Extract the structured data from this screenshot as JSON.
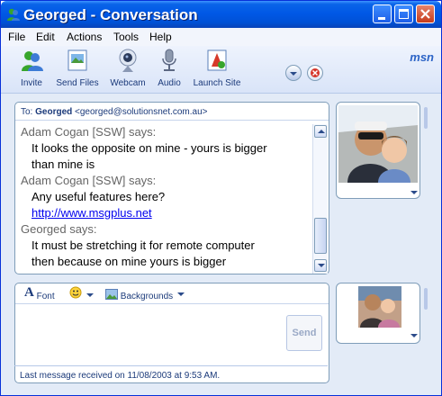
{
  "window": {
    "title": "Georged - Conversation"
  },
  "menu": [
    "File",
    "Edit",
    "Actions",
    "Tools",
    "Help"
  ],
  "toolbar": {
    "items": [
      "Invite",
      "Send Files",
      "Webcam",
      "Audio",
      "Launch Site"
    ],
    "brand": "msn"
  },
  "conversation": {
    "to_label": "To:",
    "to_name": "Georged",
    "to_email": "<georged@solutionsnet.com.au>",
    "messages": [
      {
        "who": "Adam Cogan [SSW] says:",
        "lines": [
          "It looks the opposite on mine - yours is bigger",
          "than mine is"
        ]
      },
      {
        "who": "Adam Cogan [SSW] says:",
        "lines": [
          "Any useful features here?"
        ],
        "link": "http://www.msgplus.net"
      },
      {
        "who": "Georged says:",
        "lines": [
          "It must be stretching it for remote computer",
          "then because on mine yours is bigger"
        ]
      }
    ]
  },
  "compose": {
    "font_label": "Font",
    "backgrounds_label": "Backgrounds",
    "send_label": "Send"
  },
  "status": {
    "text": "Last message received on 11/08/2003 at 9:53 AM."
  },
  "colors": {
    "titlebar": "#0058e6",
    "link": "#0000ee",
    "panel_border": "#7f9db9"
  }
}
